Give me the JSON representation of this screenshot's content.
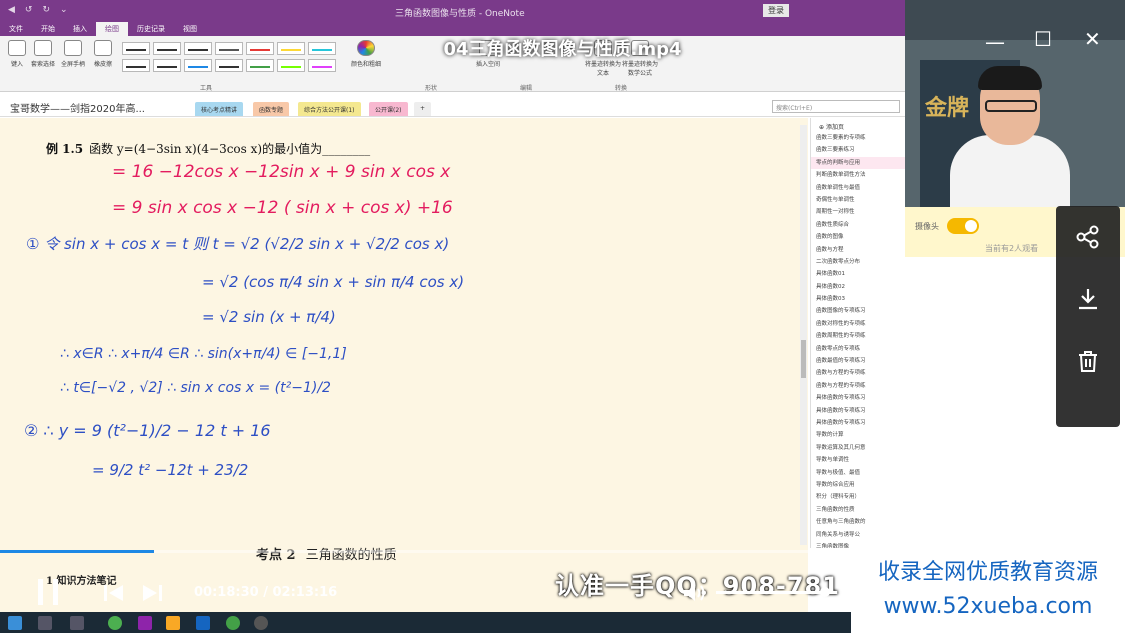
{
  "window": {
    "title": "三角函数图像与性质 - OneNote",
    "login": "登录",
    "quick_access": [
      "◀",
      "↺",
      "↻",
      "⌄"
    ]
  },
  "ribbon_tabs": [
    "文件",
    "开始",
    "插入",
    "绘图",
    "历史记录",
    "视图"
  ],
  "ribbon": {
    "tools": [
      "键入",
      "套索选择",
      "全屏手柄",
      "橡皮擦"
    ],
    "group_labels": [
      "工具",
      "形状",
      "编辑",
      "转换"
    ],
    "color_button": "颜色和粗细",
    "insert_space": "插入空间",
    "convert": [
      "将墨迹转换为文本",
      "将墨迹转换为数学公式"
    ]
  },
  "notebook": {
    "title": "宝哥数学——剑指2020年高...",
    "sections": [
      "核心考点精讲",
      "函数专题",
      "综合方法公开课(1)",
      "公开课(2)"
    ],
    "search_placeholder": "搜索(Ctrl+E)"
  },
  "page": {
    "problem_num": "例 1.5",
    "problem_text": "函数 y=(4−3sin x)(4−3cos x)的最小值为________",
    "ink": [
      "= 16 −12cos x −12sin x + 9 sin x cos x",
      "= 9 sin x cos x −12 ( sin x + cos x) +16",
      "① 令 sin x + cos x = t 则 t = √2 (√2/2 sin x + √2/2 cos x)",
      "= √2 (cos π/4 sin x + sin π/4 cos x)",
      "= √2 sin (x + π/4)",
      "∴ x∈R ∴ x+π/4 ∈R ∴ sin(x+π/4) ∈ [−1,1]",
      "∴ t∈[−√2 , √2]   ∴ sin x cos x = (t²−1)/2",
      "② ∴ y = 9 (t²−1)/2 − 12 t + 16",
      "= 9/2 t² −12t + 23/2"
    ],
    "section_heading_num": "考点 2",
    "section_heading_text": "三角函数的性质",
    "subheading": "1.知识方法笔记"
  },
  "page_list": {
    "add_page": "添加页",
    "items": [
      "函数三要素的专项练",
      "函数三要素练习",
      "零点的判断与应用",
      "判断函数单调性方法",
      "函数单调性与最值",
      "奇偶性与单调性",
      "周期性一对称性",
      "函数性质综合",
      "函数的图像",
      "函数与方程",
      "二次函数零点分布",
      "具体函数01",
      "具体函数02",
      "具体函数03",
      "函数图像的专项练习",
      "函数对称性的专项练",
      "函数周期性的专项练",
      "函数零点的专项练",
      "函数最值的专项练习",
      "函数与方程的专项练",
      "函数与方程的专项练",
      "具体函数的专项练习",
      "具体函数的专项练习",
      "具体函数的专项练习",
      "导数的计算",
      "导数运算及其几何意",
      "导数与单调性",
      "导数与极值、最值",
      "导数的综合应用",
      "积分（理科专用）",
      "三角函数的性质",
      "任意角与三角函数的",
      "同角关系与诱导公",
      "三角函数图像"
    ]
  },
  "player": {
    "title": "04三角函数图像与性质.mp4",
    "time_current": "00:18:30",
    "time_total": "02:13:16",
    "progress": 0.17,
    "volume": 0.95,
    "watermark": "认准一手QQ：908-781",
    "ad_line1": "收录全网优质教育资源",
    "ad_line2": "www.52xueba.com"
  },
  "side_panel": {
    "camera_label": "摄像头",
    "viewers": "当前有2人观看",
    "poster_text": "金牌"
  }
}
